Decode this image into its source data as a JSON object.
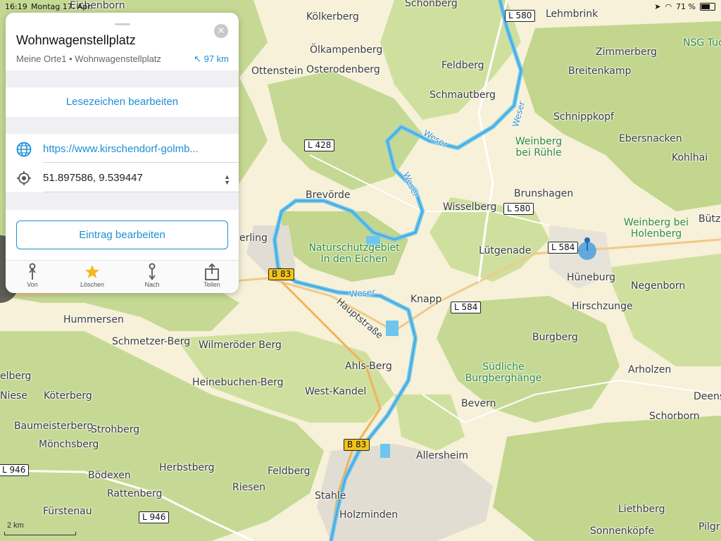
{
  "status": {
    "time": "16:19",
    "date": "Montag 17. Apr.",
    "battery": "71 %"
  },
  "panel": {
    "title": "Wohnwagenstellplatz",
    "subtitle": "Meine Orte1 • Wohnwagenstellplatz",
    "distance": "97 km",
    "edit_bookmarks": "Lesezeichen bearbeiten",
    "url": "https://www.kirschendorf-golmb...",
    "coordinates": "51.897586, 9.539447",
    "edit_entry": "Eintrag bearbeiten",
    "toolbar": [
      {
        "label": "Von",
        "icon": "from-route-icon"
      },
      {
        "label": "Löschen",
        "icon": "star-icon"
      },
      {
        "label": "Nach",
        "icon": "to-route-icon"
      },
      {
        "label": "Teilen",
        "icon": "share-icon"
      }
    ]
  },
  "map": {
    "places": [
      "Eichenborn",
      "Schönberg",
      "Lehmbrink",
      "NSG Tuc",
      "Kölkerberg",
      "Ölkampenberg",
      "Zimmerberg",
      "Ottenstein",
      "Osterodenberg",
      "Feldberg",
      "Breitenkamp",
      "Schmautberg",
      "Schnippkopf",
      "Ebersnacken",
      "Kohlhai",
      "Brevörde",
      "Brunshagen",
      "Wisselberg",
      "Lütgenade",
      "Bütze",
      "Hüneburg",
      "Negenborn",
      "Knapp",
      "Hirschzunge",
      "Hummersen",
      "Burgberg",
      "Schmetzer-Berg",
      "Wilmeröder Berg",
      "Ahls-Berg",
      "Arholzen",
      "Heinebuchen-Berg",
      "West-Kandel",
      "Niese",
      "Köterberg",
      "Bevern",
      "Deens",
      "Baumeisterberg",
      "Strohberg",
      "Schorborn",
      "Mönchsberg",
      "Allersheim",
      "Herbstberg",
      "Bödexen",
      "Feldberg",
      "Riesen",
      "Rattenberg",
      "Stahle",
      "Fürstenau",
      "Holzminden",
      "Liethberg",
      "Sonnenköpfe",
      "Pilgri",
      "elberg",
      "erling"
    ],
    "green_labels": [
      "Weinberg bei Rühle",
      "Naturschutzgebiet In den Eichen",
      "Weinberg bei Holenberg",
      "Südliche Burgberghänge"
    ],
    "water_labels": [
      "Weser",
      "Weser",
      "Weser",
      "Weser"
    ],
    "street_labels": [
      "Hauptstraße"
    ],
    "roads": [
      "L 580",
      "L 428",
      "L 580",
      "L 584",
      "L 584",
      "B 83",
      "B 83",
      "L 946",
      "L 946"
    ],
    "scale": "2 km"
  },
  "colors": {
    "accent": "#1c8fd6",
    "forest": "#c4d890",
    "field": "#f6f1d8",
    "river": "#6ec6ee"
  }
}
